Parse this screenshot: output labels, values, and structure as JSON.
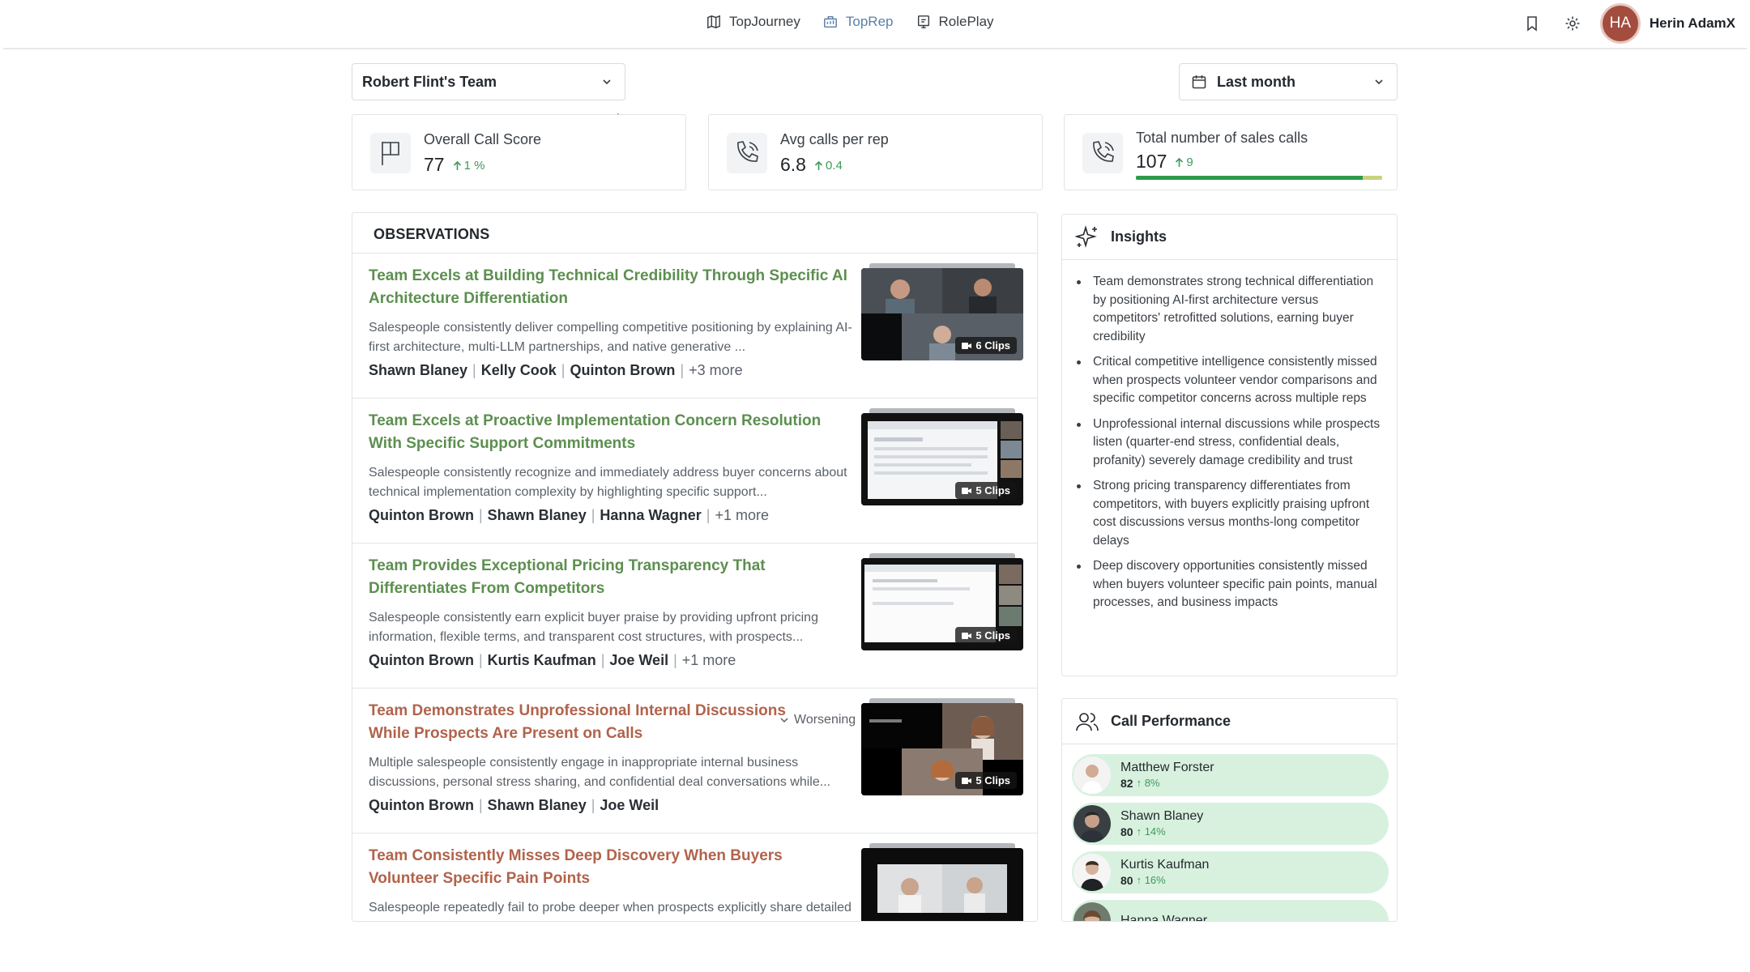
{
  "nav": {
    "items": [
      {
        "label": "TopJourney",
        "icon": "map-icon",
        "active": false
      },
      {
        "label": "TopRep",
        "icon": "chart-icon",
        "active": true
      },
      {
        "label": "RolePlay",
        "icon": "screen-icon",
        "active": false
      }
    ],
    "user": {
      "initials": "HA",
      "name": "Herin AdamX"
    }
  },
  "filters": {
    "team": "Robert Flint's Team",
    "date_range": "Last month"
  },
  "stats": [
    {
      "label": "Overall Call Score",
      "value": "77",
      "change": "1 %"
    },
    {
      "label": "Avg calls per rep",
      "value": "6.8",
      "change": "0.4"
    },
    {
      "label": "Total number of sales calls",
      "value": "107",
      "change": "9",
      "progress": 0.92
    }
  ],
  "observations": {
    "header": "OBSERVATIONS",
    "items": [
      {
        "title": "Team Excels at Building Technical Credibility Through Specific AI Architecture Differentiation",
        "description": "Salespeople consistently deliver compelling competitive positioning by explaining AI-first architecture, multi-LLM partnerships, and native generative ...",
        "people": [
          "Shawn Blaney",
          "Kelly Cook",
          "Quinton Brown"
        ],
        "more": "+3 more",
        "clips": "6 Clips",
        "tone": "positive",
        "trend": ""
      },
      {
        "title": "Team Excels at Proactive Implementation Concern Resolution With Specific Support Commitments",
        "description": "Salespeople consistently recognize and immediately address buyer concerns about technical implementation complexity by highlighting specific support...",
        "people": [
          "Quinton Brown",
          "Shawn Blaney",
          "Hanna Wagner"
        ],
        "more": "+1 more",
        "clips": "5 Clips",
        "tone": "positive",
        "trend": ""
      },
      {
        "title": "Team Provides Exceptional Pricing Transparency That Differentiates From Competitors",
        "description": "Salespeople consistently earn explicit buyer praise by providing upfront pricing information, flexible terms, and transparent cost structures, with prospects...",
        "people": [
          "Quinton Brown",
          "Kurtis Kaufman",
          "Joe Weil"
        ],
        "more": "+1 more",
        "clips": "5 Clips",
        "tone": "positive",
        "trend": ""
      },
      {
        "title": "Team Demonstrates Unprofessional Internal Discussions While Prospects Are Present on Calls",
        "description": "Multiple salespeople consistently engage in inappropriate internal business discussions, personal stress sharing, and confidential deal conversations while...",
        "people": [
          "Quinton Brown",
          "Shawn Blaney",
          "Joe Weil"
        ],
        "more": "",
        "clips": "5 Clips",
        "tone": "negative",
        "trend": "Worsening"
      },
      {
        "title": "Team Consistently Misses Deep Discovery When Buyers Volunteer Specific Pain Points",
        "description": "Salespeople repeatedly fail to probe deeper when prospects explicitly share detailed challenges, manual processes, stakeholder frustrations, or business",
        "people": [],
        "more": "",
        "clips": "",
        "tone": "negative",
        "trend": ""
      }
    ]
  },
  "insights": {
    "title": "Insights",
    "items": [
      "Team demonstrates strong technical differentiation by positioning AI-first architecture versus competitors' retrofitted solutions, earning buyer credibility",
      "Critical competitive intelligence consistently missed when prospects volunteer vendor comparisons and specific competitor concerns across multiple reps",
      "Unprofessional internal discussions while prospects listen (quarter-end stress, confidential deals, profanity) severely damage credibility and trust",
      "Strong pricing transparency differentiates from competitors, with buyers explicitly praising upfront cost discussions versus months-long competitor delays",
      "Deep discovery opportunities consistently missed when buyers volunteer specific pain points, manual processes, and business impacts"
    ]
  },
  "performance": {
    "title": "Call Performance",
    "reps": [
      {
        "name": "Matthew Forster",
        "score": "82",
        "change": "8%"
      },
      {
        "name": "Shawn Blaney",
        "score": "80",
        "change": "14%"
      },
      {
        "name": "Kurtis Kaufman",
        "score": "80",
        "change": "16%"
      },
      {
        "name": "Hanna Wagner",
        "score": "",
        "change": ""
      }
    ]
  },
  "colors": {
    "positive_title": "#5c8f4f",
    "negative_title": "#b1634b",
    "active_nav": "#5b7fa6",
    "up_change": "#3c9a5b",
    "perf_row_bg": "#d8f1df"
  }
}
